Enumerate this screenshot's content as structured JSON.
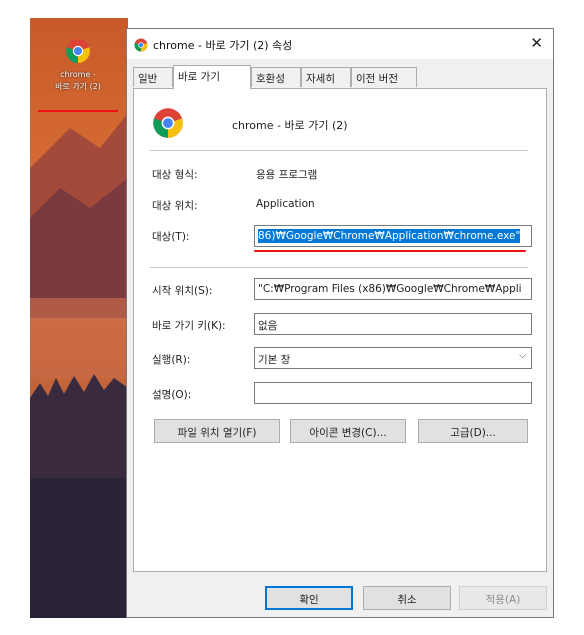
{
  "desktop": {
    "icon_caption_line1": "chrome -",
    "icon_caption_line2": "바로 가기 (2)",
    "icon": "chrome-icon"
  },
  "dialog": {
    "title": "chrome - 바로 가기 (2) 속성",
    "close_glyph": "✕",
    "tabs": [
      {
        "label": "일반"
      },
      {
        "label": "바로 가기"
      },
      {
        "label": "호환성"
      },
      {
        "label": "자세히"
      },
      {
        "label": "이전 버전"
      }
    ],
    "shortcut_name": "chrome - 바로 가기 (2)",
    "fields": {
      "target_type_label": "대상 형식:",
      "target_type_value": "응용 프로그램",
      "target_location_label": "대상 위치:",
      "target_location_value": "Application",
      "target_label": "대상(T):",
      "target_value": "86)₩Google₩Chrome₩Application₩chrome.exe\"",
      "start_in_label": "시작 위치(S):",
      "start_in_value": "\"C:₩Program Files (x86)₩Google₩Chrome₩Appli",
      "shortcut_key_label": "바로 가기 키(K):",
      "shortcut_key_value": "없음",
      "run_label": "실행(R):",
      "run_value": "기본 창",
      "comment_label": "설명(O):",
      "comment_value": ""
    },
    "buttons": {
      "open_location": "파일 위치 열기(F)",
      "change_icon": "아이콘 변경(C)...",
      "advanced": "고급(D)...",
      "ok": "확인",
      "cancel": "취소",
      "apply": "적용(A)"
    },
    "colors": {
      "selection": "#0078d7",
      "annotation_underline": "#e11111"
    }
  }
}
